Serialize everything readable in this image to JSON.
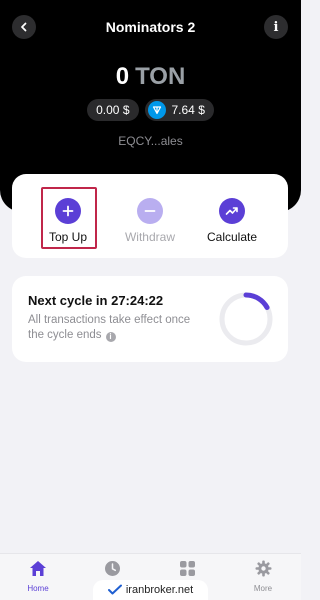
{
  "header": {
    "title": "Nominators 2",
    "balance_amount": "0",
    "balance_currency": "TON",
    "usd_balance": "0.00 $",
    "ton_price": "7.64 $",
    "address": "EQCY...ales"
  },
  "actions": {
    "top_up": "Top Up",
    "withdraw": "Withdraw",
    "calculate": "Calculate"
  },
  "cycle": {
    "title": "Next cycle in 27:24:22",
    "description": "All transactions take effect once the cycle ends",
    "progress": 0.17
  },
  "tabs": {
    "home": "Home",
    "more": "More"
  },
  "watermark": "iranbroker.net",
  "colors": {
    "accent": "#5b3fd6",
    "accent_disabled": "#b9aef0",
    "ton_blue": "#0098ea",
    "highlight": "#c0264a"
  },
  "icons": [
    "back-arrow-icon",
    "info-icon",
    "ton-icon",
    "plus-icon",
    "minus-icon",
    "trend-up-icon",
    "house-icon",
    "clock-icon",
    "grid-icon",
    "gear-icon"
  ]
}
